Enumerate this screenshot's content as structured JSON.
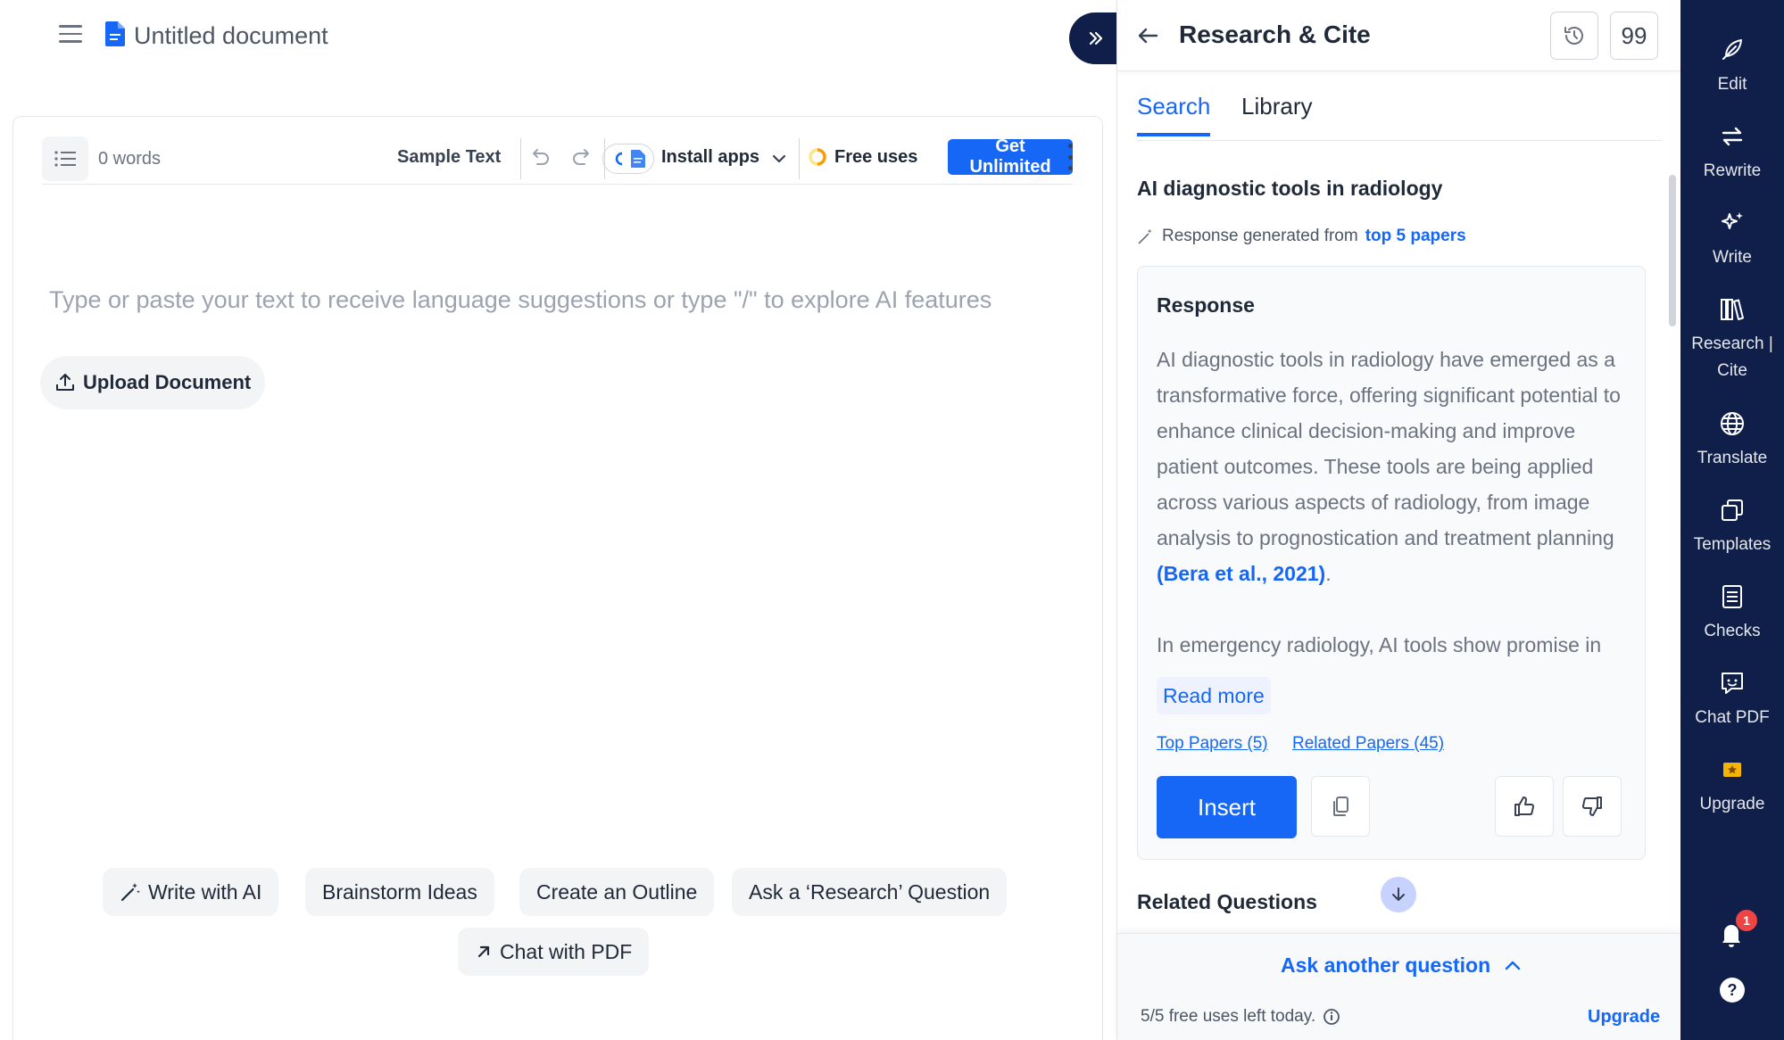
{
  "document": {
    "title": "Untitled document"
  },
  "toolbar": {
    "word_count": "0 words",
    "sample_text": "Sample Text",
    "install_apps": "Install apps",
    "free_uses": "Free uses",
    "get_unlimited": "Get Unlimited"
  },
  "editor": {
    "placeholder": "Type or paste your text to receive language suggestions or type \"/\" to explore AI features",
    "upload": "Upload Document",
    "suggestions": [
      "Write with AI",
      "Brainstorm Ideas",
      "Create an Outline",
      "Ask a ‘Research’ Question",
      "Chat with PDF"
    ]
  },
  "panel": {
    "title": "Research & Cite",
    "quote_label": "99",
    "tabs": [
      "Search",
      "Library"
    ],
    "query": "AI diagnostic tools in radiology",
    "generated_prefix": "Response generated from",
    "generated_link": "top 5 papers",
    "response": {
      "heading": "Response",
      "paragraph1": "AI diagnostic tools in radiology have emerged as a transformative force, offering significant potential to enhance clinical decision-making and improve patient outcomes. These tools are being applied across various aspects of radiology, from image analysis to prognostication and treatment planning",
      "citation": "(Bera et al., 2021)",
      "paragraph1_end": ".",
      "paragraph2": "In emergency radiology, AI tools show promise in",
      "read_more": "Read more",
      "top_papers": "Top Papers (5)",
      "related_papers": "Related Papers (45)",
      "insert": "Insert"
    },
    "related_questions": "Related Questions",
    "ask_another": "Ask another question",
    "uses_left": "5/5 free uses left today.",
    "upgrade": "Upgrade"
  },
  "rail": {
    "items": [
      "Edit",
      "Rewrite",
      "Write",
      "Research | Cite",
      "Translate",
      "Templates",
      "Checks",
      "Chat PDF",
      "Upgrade"
    ],
    "notification_count": "1",
    "help": "?"
  },
  "colors": {
    "accent": "#1667f5",
    "rail": "#0f1f49"
  }
}
